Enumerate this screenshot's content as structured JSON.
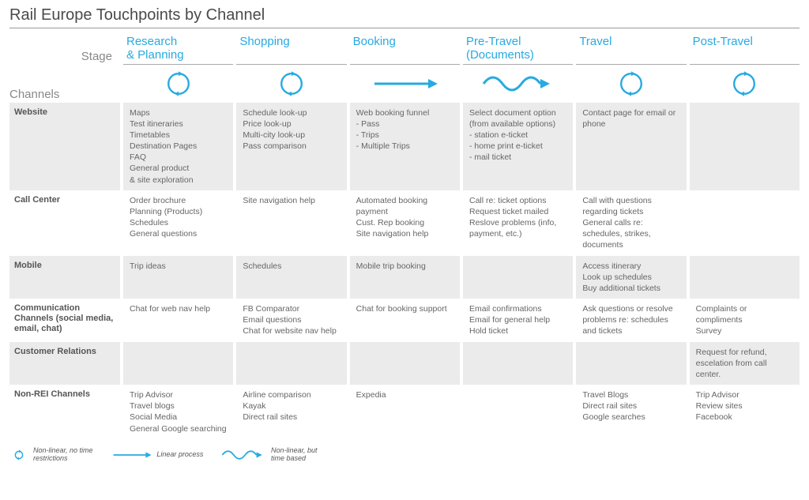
{
  "title": "Rail Europe Touchpoints by Channel",
  "stageLabel": "Stage",
  "channelsLabel": "Channels",
  "stages": [
    {
      "label": "Research\n& Planning",
      "icon": "cycle"
    },
    {
      "label": "Shopping",
      "icon": "cycle"
    },
    {
      "label": "Booking",
      "icon": "arrow"
    },
    {
      "label": "Pre-Travel\n(Documents)",
      "icon": "wave"
    },
    {
      "label": "Travel",
      "icon": "cycle"
    },
    {
      "label": "Post-Travel",
      "icon": "cycle"
    }
  ],
  "channels": [
    {
      "name": "Website",
      "shade": true,
      "cells": [
        "Maps\nTest itineraries\nTimetables\nDestination Pages\nFAQ\nGeneral product\n& site exploration",
        "Schedule look-up\nPrice look-up\nMulti-city look-up\nPass comparison",
        "Web booking funnel\n- Pass\n- Trips\n- Multiple Trips",
        "Select document option (from available options)\n- station e-ticket\n- home print e-ticket\n- mail ticket",
        "Contact page for email or phone",
        ""
      ]
    },
    {
      "name": "Call Center",
      "shade": false,
      "cells": [
        "Order brochure\nPlanning (Products)\nSchedules\nGeneral questions",
        "Site navigation help",
        "Automated booking payment\nCust. Rep booking\nSite navigation help",
        "Call re: ticket options\nRequest ticket mailed\nReslove problems (info, payment, etc.)",
        "Call with questions regarding tickets\nGeneral calls re: schedules, strikes, documents",
        ""
      ]
    },
    {
      "name": "Mobile",
      "shade": true,
      "cells": [
        "Trip ideas",
        "Schedules",
        "Mobile trip booking",
        "",
        "Access itinerary\nLook up schedules\nBuy additional tickets",
        ""
      ]
    },
    {
      "name": "Communication Channels (social media, email, chat)",
      "shade": false,
      "cells": [
        "Chat for web nav help",
        "FB Comparator\nEmail questions\nChat for website nav help",
        "Chat for booking support",
        "Email confirmations\nEmail for general help\nHold ticket",
        "Ask questions or resolve problems re: schedules and tickets",
        "Complaints or compliments\nSurvey"
      ]
    },
    {
      "name": "Customer Relations",
      "shade": true,
      "cells": [
        "",
        "",
        "",
        "",
        "",
        "Request for refund, escelation from call center."
      ]
    },
    {
      "name": "Non-REI Channels",
      "shade": false,
      "cells": [
        "Trip Advisor\nTravel blogs\nSocial Media\nGeneral Google searching",
        "Airline comparison\nKayak\nDirect rail sites",
        "Expedia",
        "",
        "Travel Blogs\nDirect rail sites\nGoogle searches",
        "Trip Advisor\nReview sites\nFacebook"
      ]
    }
  ],
  "legend": [
    {
      "icon": "cycle",
      "text": "Non-linear, no time\nrestrictions"
    },
    {
      "icon": "arrow",
      "text": "Linear process"
    },
    {
      "icon": "wave",
      "text": "Non-linear, but\ntime based"
    }
  ],
  "color": "#27aae1"
}
